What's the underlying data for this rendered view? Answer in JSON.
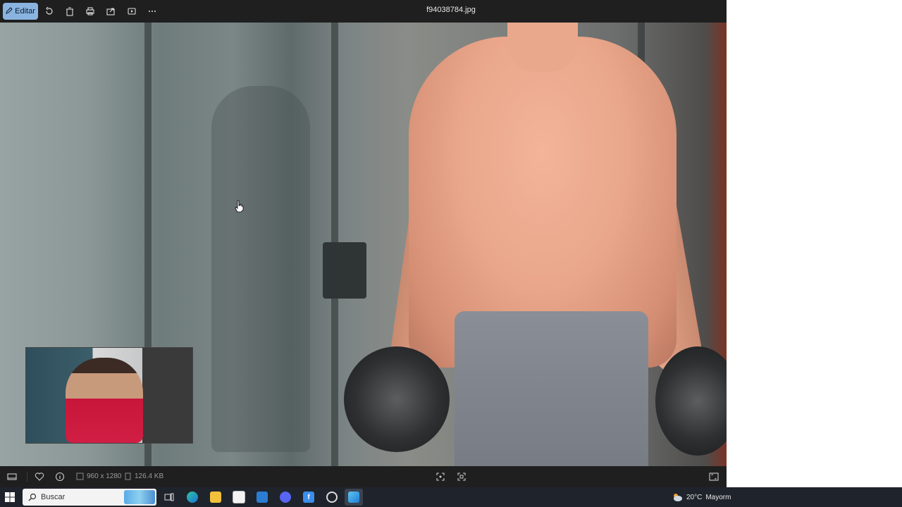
{
  "toolbar": {
    "edit_label": "Editar",
    "filename": "f94038784.jpg",
    "icons": [
      "rotate-icon",
      "delete-icon",
      "print-icon",
      "share-icon",
      "slideshow-icon",
      "more-icon"
    ]
  },
  "bottombar": {
    "dimensions": "960 x 1280",
    "filesize": "126.4 KB"
  },
  "taskbar": {
    "search_label": "Buscar",
    "weather_temp": "20°C",
    "weather_text": "Mayorm"
  },
  "colors": {
    "accent": "#8ab4e0",
    "toolbar_bg": "#1f1f1f",
    "taskbar_bg": "#1f232b"
  }
}
